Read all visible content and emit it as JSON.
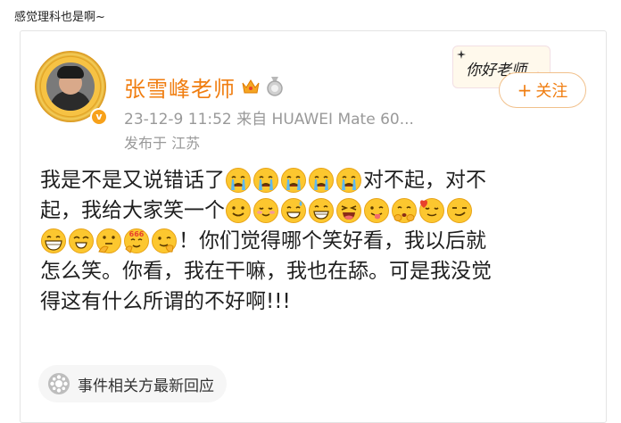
{
  "caption": "感觉理科也是啊~",
  "post": {
    "author": "张雪峰老师",
    "timestamp": "23-12-9 11:52",
    "source": "来自 HUAWEI Mate 60...",
    "location": "发布于 江苏",
    "sticker_text": "你好老师",
    "follow_label": "关注",
    "follow_plus": "+",
    "lines": [
      {
        "segments": [
          {
            "t": "text",
            "v": "我是不是又说错话了"
          },
          {
            "t": "emoji",
            "v": "cry"
          },
          {
            "t": "emoji",
            "v": "cry"
          },
          {
            "t": "emoji",
            "v": "cry"
          },
          {
            "t": "emoji",
            "v": "cry"
          },
          {
            "t": "emoji",
            "v": "cry"
          },
          {
            "t": "text",
            "v": "对不起，对不"
          }
        ]
      },
      {
        "segments": [
          {
            "t": "text",
            "v": "起，我给大家笑一个"
          },
          {
            "t": "emoji",
            "v": "smile"
          },
          {
            "t": "emoji",
            "v": "shy"
          },
          {
            "t": "emoji",
            "v": "sweat-grin"
          },
          {
            "t": "emoji",
            "v": "grin"
          },
          {
            "t": "emoji",
            "v": "laugh"
          },
          {
            "t": "emoji",
            "v": "tongue"
          },
          {
            "t": "emoji",
            "v": "cover-mouth"
          },
          {
            "t": "emoji",
            "v": "heart-blush"
          },
          {
            "t": "emoji",
            "v": "smirk"
          }
        ]
      },
      {
        "segments": [
          {
            "t": "emoji",
            "v": "big-grin"
          },
          {
            "t": "emoji",
            "v": "squint"
          },
          {
            "t": "emoji",
            "v": "think"
          },
          {
            "t": "emoji",
            "v": "666"
          },
          {
            "t": "emoji",
            "v": "wink"
          },
          {
            "t": "text",
            "v": "！你们觉得哪个笑好看，我以后就"
          }
        ]
      },
      {
        "segments": [
          {
            "t": "text",
            "v": "怎么笑。你看，我在干嘛，我也在舔。可是我没觉"
          }
        ]
      },
      {
        "segments": [
          {
            "t": "text",
            "v": "得这有什么所谓的不好啊!!!"
          }
        ]
      }
    ],
    "event_label": "事件相关方最新回应"
  },
  "icons": {
    "vip": "vip-badge-icon",
    "crown": "crown-icon",
    "medal": "medal-icon",
    "event": "event-icon"
  },
  "colors": {
    "accent": "#f07e11",
    "meta": "#999999",
    "emoji_face": "#fcc72f"
  }
}
